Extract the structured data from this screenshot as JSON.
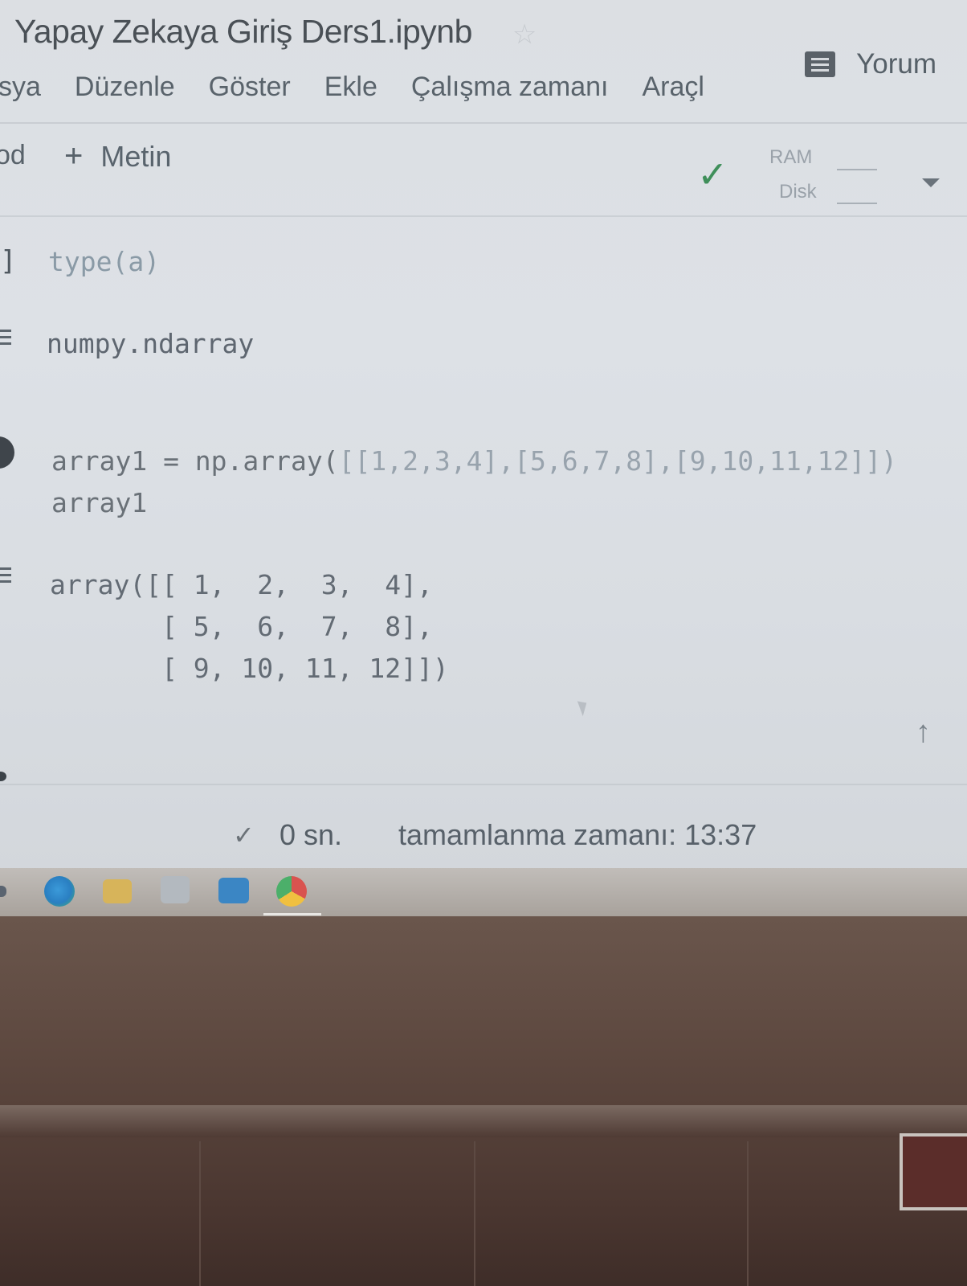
{
  "notebook": {
    "title": "Yapay Zekaya Giriş Ders1.ipynb",
    "comment_label": "Yorum"
  },
  "menu": {
    "items": [
      "sya",
      "Düzenle",
      "Göster",
      "Ekle",
      "Çalışma zamanı",
      "Araçl"
    ]
  },
  "toolbar": {
    "code_cut": "od",
    "text_label": "Metin",
    "ram_label": "RAM",
    "disk_label": "Disk"
  },
  "cells": {
    "cell1": {
      "bracket": "]",
      "code": "type(a)",
      "output": "numpy.ndarray"
    },
    "cell2": {
      "code_line1_a": "array1 = np.array(",
      "code_line1_b": "[[1,2,3,4],[5,6,7,8],[9,10,11,12]]",
      "code_line1_c": ")",
      "code_line2": "array1",
      "output_line1": "array([[ 1,  2,  3,  4],",
      "output_line2": "       [ 5,  6,  7,  8],",
      "output_line3": "       [ 9, 10, 11, 12]])"
    }
  },
  "status": {
    "duration": "0 sn.",
    "completion": "tamamlanma zamanı: 13:37"
  },
  "icons": {
    "star": "star-icon",
    "comment": "comment-icon",
    "check": "check-icon",
    "up_arrow": "arrow-up-icon"
  },
  "colors": {
    "check_green": "#3f8f5a",
    "screen_bg": "#dcdfe3"
  }
}
